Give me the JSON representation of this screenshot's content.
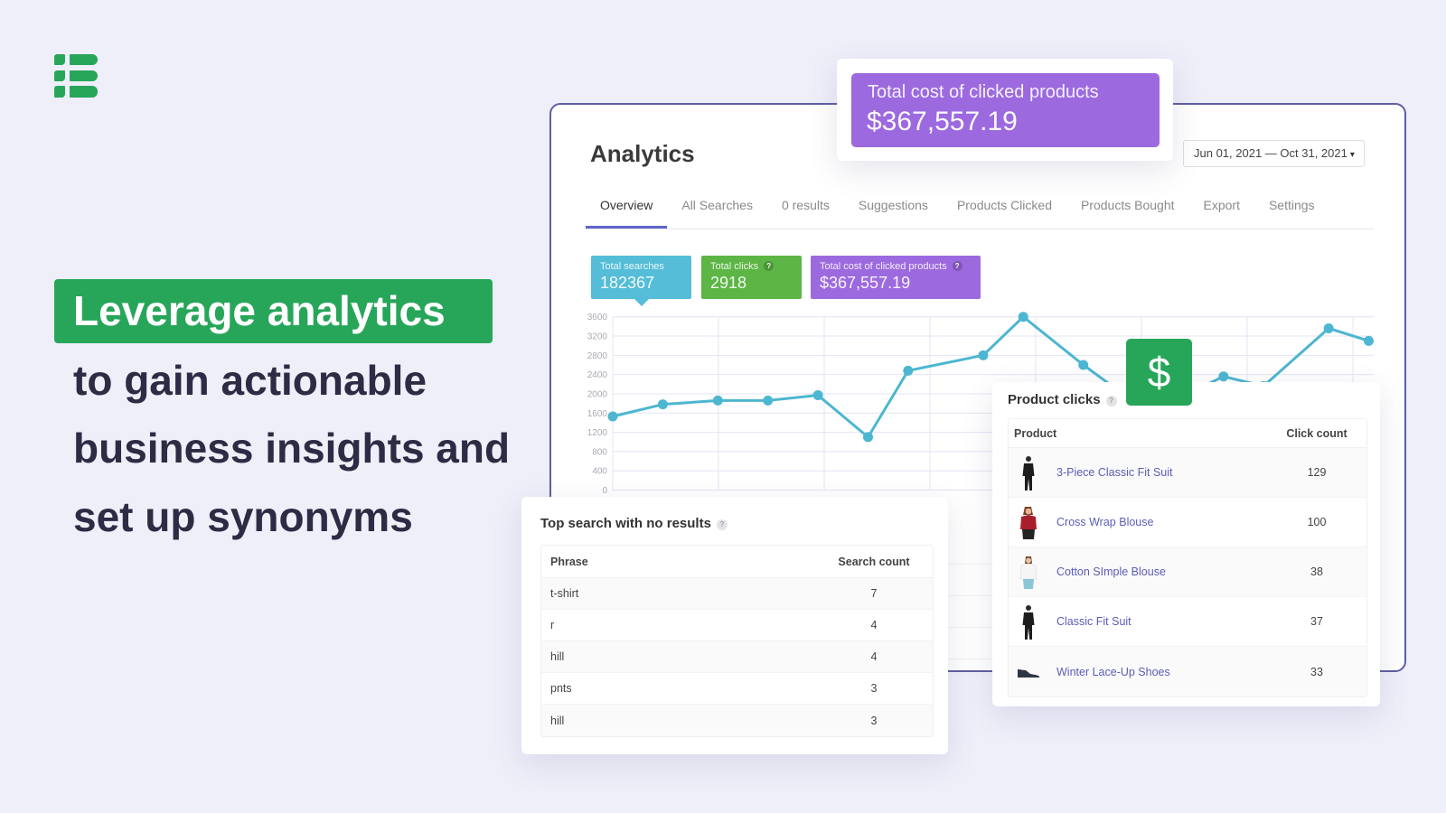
{
  "logo": {
    "icon": "stacked-list-logo"
  },
  "headline": {
    "highlight": "Leverage analytics",
    "lines": [
      "to gain actionable",
      "business insights and",
      "set up synonyms"
    ]
  },
  "analytics": {
    "title": "Analytics",
    "date_range": "Jun 01, 2021 — Oct 31, 2021",
    "date_caret": "▾",
    "tabs": [
      {
        "label": "Overview",
        "active": true
      },
      {
        "label": "All Searches",
        "active": false
      },
      {
        "label": "0 results",
        "active": false
      },
      {
        "label": "Suggestions",
        "active": false
      },
      {
        "label": "Products Clicked",
        "active": false
      },
      {
        "label": "Products Bought",
        "active": false
      },
      {
        "label": "Export",
        "active": false
      },
      {
        "label": "Settings",
        "active": false
      }
    ],
    "stats": [
      {
        "label": "Total searches",
        "value": "182367",
        "color": "#55bdd7",
        "selected": true
      },
      {
        "label": "Total clicks",
        "value": "2918",
        "color": "#5cb545",
        "help": "?"
      },
      {
        "label": "Total cost of clicked products",
        "value": "$367,557.19",
        "color": "#9c6ade",
        "help": "?"
      }
    ]
  },
  "highlight_card": {
    "label": "Total cost of clicked products",
    "value": "$367,557.19",
    "color": "#9c6ade"
  },
  "money_badge": {
    "glyph": "$",
    "color": "#27a65a"
  },
  "product_clicks": {
    "title": "Product clicks",
    "help": "?",
    "columns": [
      "Product",
      "Click count"
    ],
    "rows": [
      {
        "name": "3-Piece Classic Fit Suit",
        "count": "129",
        "image": "man in black three-piece suit"
      },
      {
        "name": "Cross Wrap Blouse",
        "count": "100",
        "image": "woman in red wrap blouse"
      },
      {
        "name": "Cotton SImple Blouse",
        "count": "38",
        "image": "woman in white blouse"
      },
      {
        "name": "Classic Fit Suit",
        "count": "37",
        "image": "man in black suit"
      },
      {
        "name": "Winter Lace-Up Shoes",
        "count": "33",
        "image": "dark lace-up shoe"
      }
    ]
  },
  "no_results": {
    "title": "Top search with no results",
    "help": "?",
    "columns": [
      "Phrase",
      "Search count"
    ],
    "rows": [
      {
        "phrase": "t-shirt",
        "count": "7"
      },
      {
        "phrase": "r",
        "count": "4"
      },
      {
        "phrase": "hill",
        "count": "4"
      },
      {
        "phrase": "pnts",
        "count": "3"
      },
      {
        "phrase": "hill",
        "count": "3"
      }
    ]
  },
  "colors": {
    "brand_green": "#27a65a",
    "background": "#efeffa",
    "frame_border": "#5f5ea3",
    "tab_active": "#5c66c7",
    "link": "#5a5db8",
    "headline_text": "#2c2c44"
  },
  "chart_data": {
    "type": "line",
    "title": "",
    "xlabel": "",
    "ylabel": "",
    "x": [
      0,
      10,
      21,
      31,
      41,
      51,
      59,
      74,
      82,
      94,
      107,
      122,
      130,
      143,
      151
    ],
    "xlim": [
      0,
      152
    ],
    "ylim": [
      0,
      3600
    ],
    "yticks": [
      0,
      400,
      800,
      1200,
      1600,
      2000,
      2400,
      2800,
      3200,
      3600
    ],
    "grid": true,
    "legend": "none",
    "series": [
      {
        "name": "Total searches",
        "color": "#4db6d0",
        "values": [
          1530,
          1780,
          1860,
          1860,
          1970,
          1100,
          2480,
          2800,
          3600,
          2600,
          1610,
          2360,
          2160,
          3360,
          3100
        ]
      }
    ]
  }
}
